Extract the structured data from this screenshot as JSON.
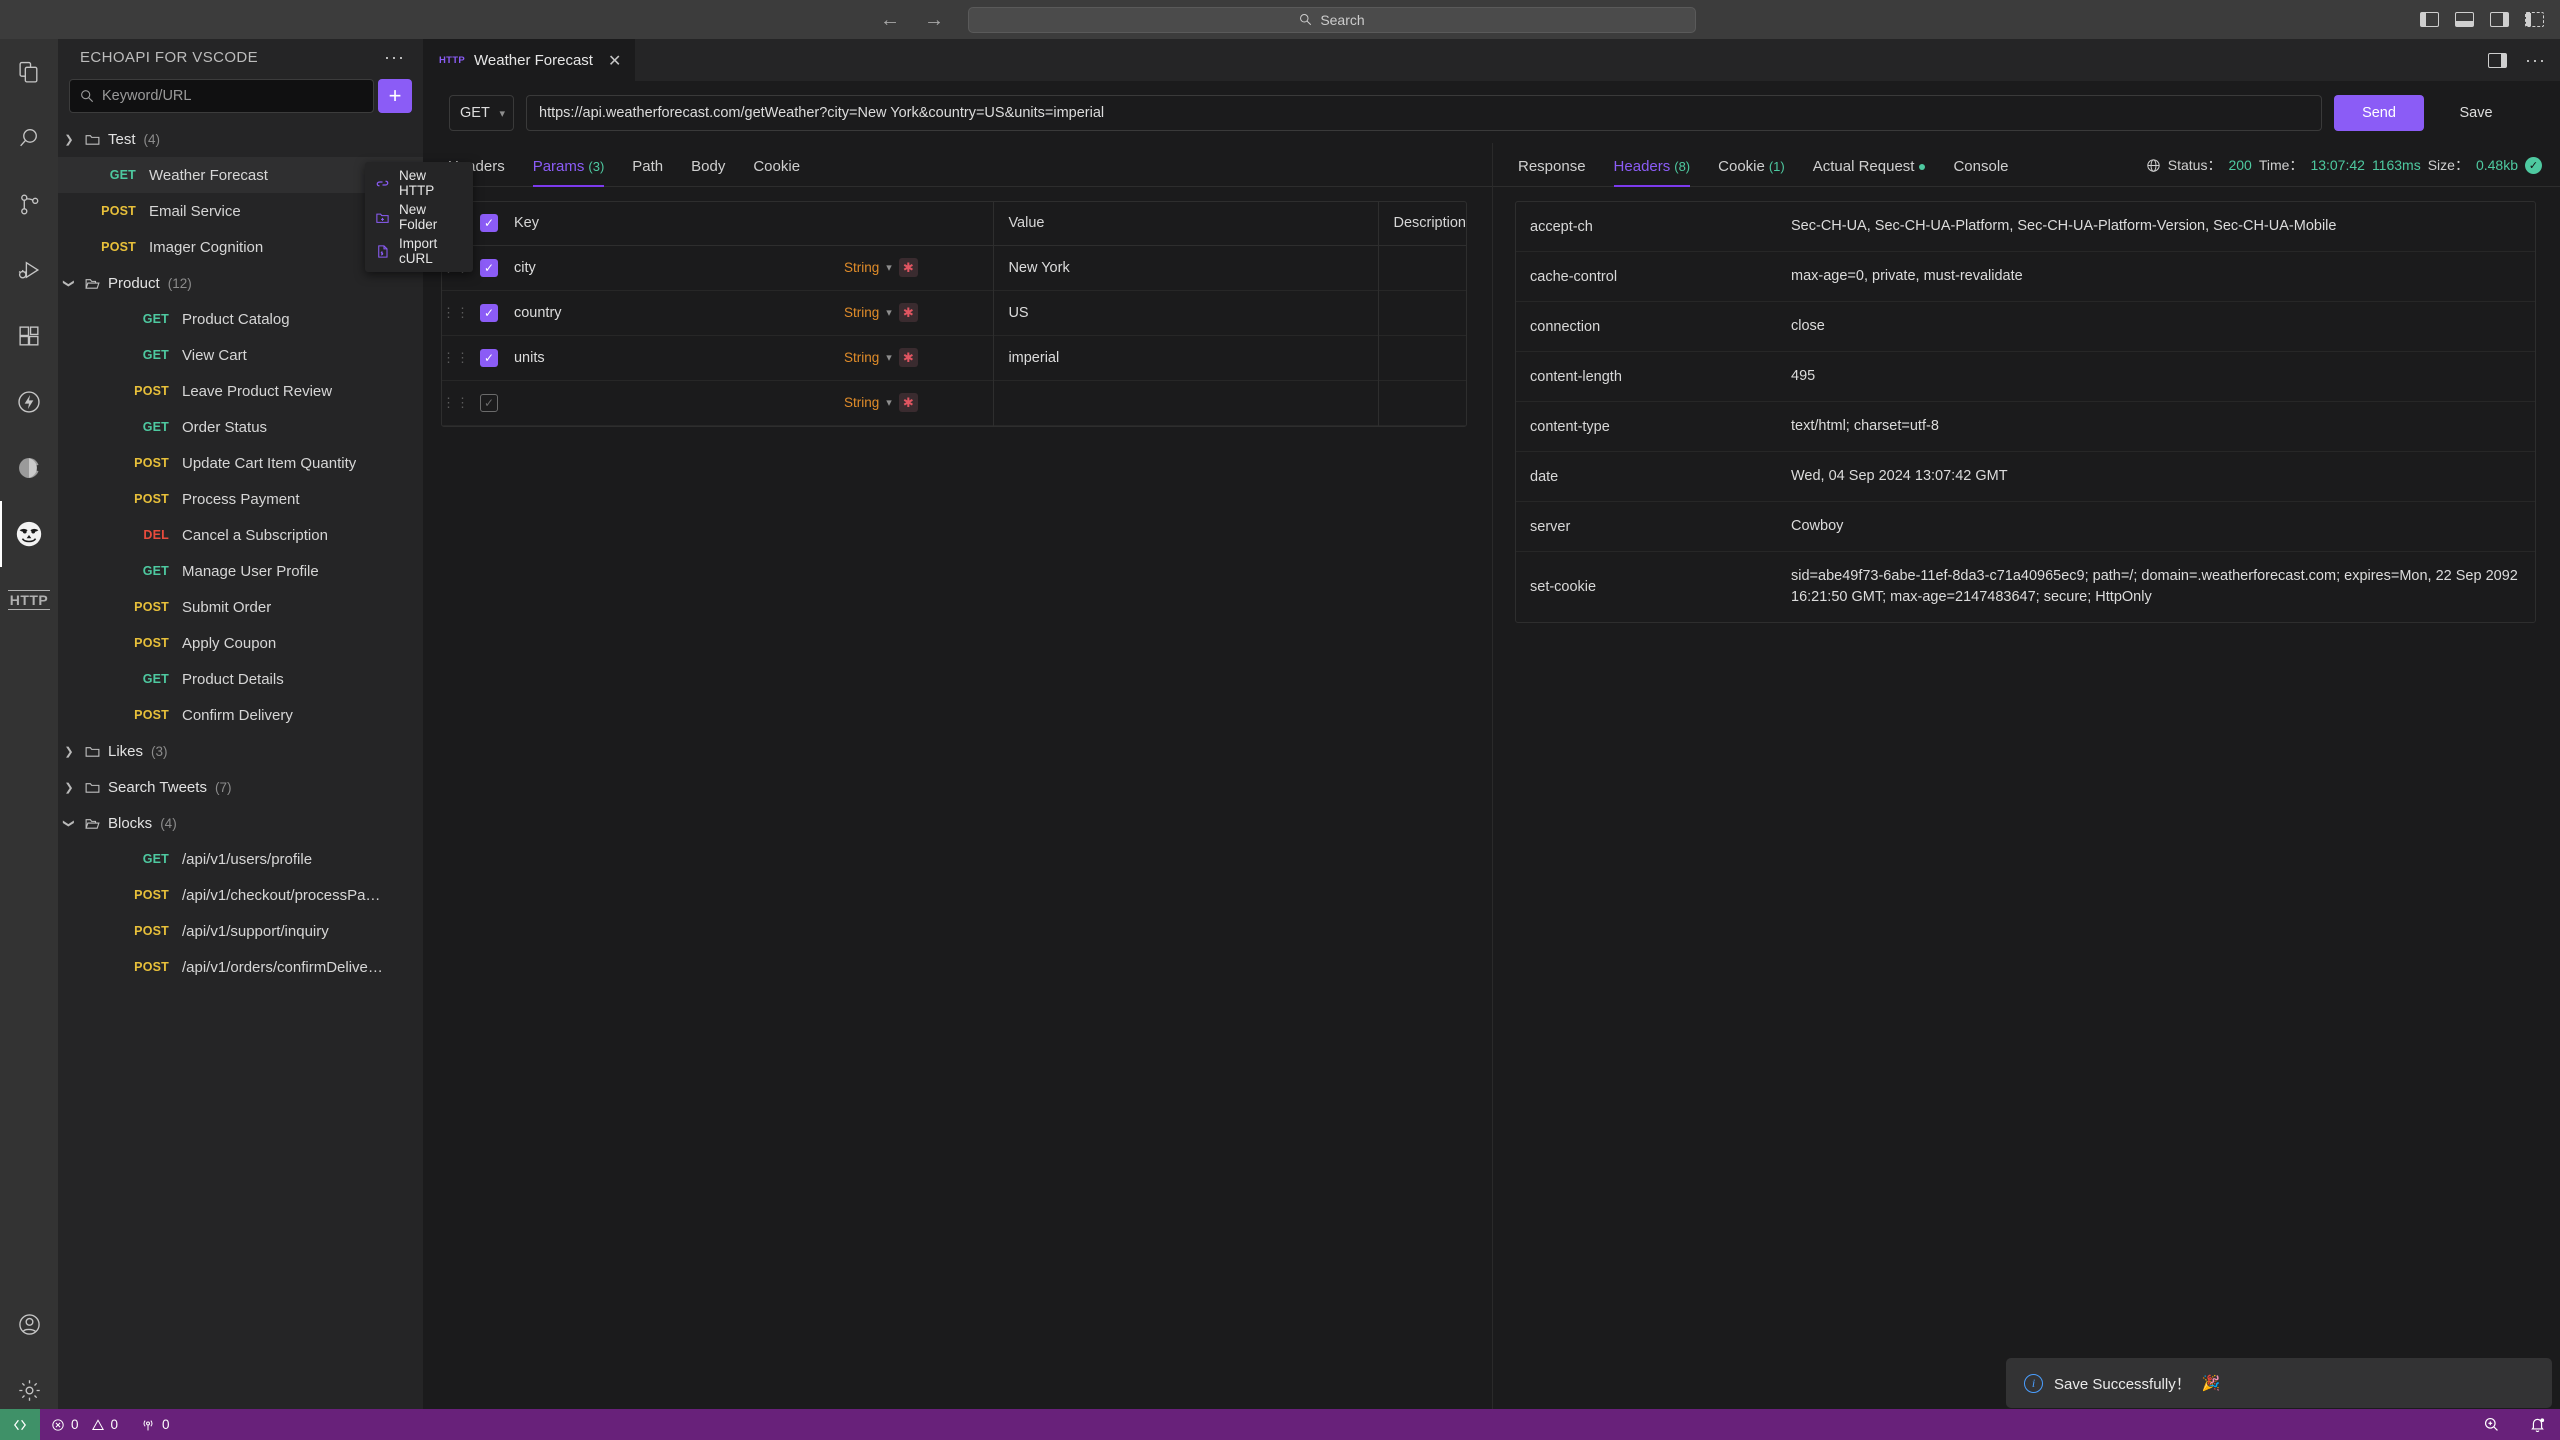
{
  "titlebar": {
    "search_placeholder": "Search",
    "back_icon": "arrow-left-icon",
    "forward_icon": "arrow-right-icon"
  },
  "activitybar": {
    "items": [
      {
        "icon": "explorer-files-icon",
        "active": false
      },
      {
        "icon": "search-icon",
        "active": false
      },
      {
        "icon": "source-control-branch-icon",
        "active": false
      },
      {
        "icon": "run-and-debug-icon",
        "active": false
      },
      {
        "icon": "extensions-icon",
        "active": false
      },
      {
        "icon": "lightning-bolt-circle-icon",
        "active": false
      },
      {
        "icon": "pie-chart-icon",
        "active": false
      },
      {
        "icon": "echoapi-owl-icon",
        "active": true
      },
      {
        "icon": "http-text-icon",
        "active": false
      }
    ],
    "bottom": [
      {
        "icon": "account-icon"
      },
      {
        "icon": "gear-icon"
      }
    ],
    "http_label": "HTTP"
  },
  "sidebar": {
    "title": "ECHOAPI FOR VSCODE",
    "more_label": "···",
    "search_placeholder": "Keyword/URL",
    "add_label": "+",
    "context_menu": [
      {
        "label": "New HTTP",
        "icon": "http-new-icon"
      },
      {
        "label": "New Folder",
        "icon": "folder-plus-icon"
      },
      {
        "label": "Import cURL",
        "icon": "import-curl-icon"
      }
    ],
    "tree": [
      {
        "kind": "folder",
        "name": "Test",
        "count": "(4)",
        "expanded": false,
        "indent": 0
      },
      {
        "kind": "request",
        "method": "GET",
        "name": "Weather Forecast",
        "selected": true,
        "indent": 0
      },
      {
        "kind": "request",
        "method": "POST",
        "name": "Email Service",
        "selected": false,
        "indent": 0
      },
      {
        "kind": "request",
        "method": "POST",
        "name": "Imager Cognition",
        "selected": false,
        "indent": 0
      },
      {
        "kind": "folder",
        "name": "Product",
        "count": "(12)",
        "expanded": true,
        "indent": 0
      },
      {
        "kind": "request",
        "method": "GET",
        "name": "Product Catalog",
        "selected": false,
        "indent": 1
      },
      {
        "kind": "request",
        "method": "GET",
        "name": "View Cart",
        "selected": false,
        "indent": 1
      },
      {
        "kind": "request",
        "method": "POST",
        "name": "Leave Product Review",
        "selected": false,
        "indent": 1
      },
      {
        "kind": "request",
        "method": "GET",
        "name": "Order Status",
        "selected": false,
        "indent": 1
      },
      {
        "kind": "request",
        "method": "POST",
        "name": "Update Cart Item Quantity",
        "selected": false,
        "indent": 1
      },
      {
        "kind": "request",
        "method": "POST",
        "name": "Process Payment",
        "selected": false,
        "indent": 1
      },
      {
        "kind": "request",
        "method": "DEL",
        "name": "Cancel a Subscription",
        "selected": false,
        "indent": 1
      },
      {
        "kind": "request",
        "method": "GET",
        "name": "Manage User Profile",
        "selected": false,
        "indent": 1
      },
      {
        "kind": "request",
        "method": "POST",
        "name": "Submit Order",
        "selected": false,
        "indent": 1
      },
      {
        "kind": "request",
        "method": "POST",
        "name": "Apply Coupon",
        "selected": false,
        "indent": 1
      },
      {
        "kind": "request",
        "method": "GET",
        "name": "Product Details",
        "selected": false,
        "indent": 1
      },
      {
        "kind": "request",
        "method": "POST",
        "name": "Confirm Delivery",
        "selected": false,
        "indent": 1
      },
      {
        "kind": "folder",
        "name": "Likes",
        "count": "(3)",
        "expanded": false,
        "indent": 0
      },
      {
        "kind": "folder",
        "name": "Search Tweets",
        "count": "(7)",
        "expanded": false,
        "indent": 0
      },
      {
        "kind": "folder",
        "name": "Blocks",
        "count": "(4)",
        "expanded": true,
        "indent": 0
      },
      {
        "kind": "request",
        "method": "GET",
        "name": "/api/v1/users/profile",
        "selected": false,
        "indent": 1
      },
      {
        "kind": "request",
        "method": "POST",
        "name": "/api/v1/checkout/processPa…",
        "selected": false,
        "indent": 1
      },
      {
        "kind": "request",
        "method": "POST",
        "name": "/api/v1/support/inquiry",
        "selected": false,
        "indent": 1
      },
      {
        "kind": "request",
        "method": "POST",
        "name": "/api/v1/orders/confirmDelive…",
        "selected": false,
        "indent": 1
      }
    ]
  },
  "editor": {
    "tab": {
      "badge": "HTTP",
      "title": "Weather Forecast",
      "close": "✕"
    },
    "request": {
      "method": "GET",
      "url": "https://api.weatherforecast.com/getWeather?city=New York&country=US&units=imperial",
      "send_label": "Send",
      "save_label": "Save"
    },
    "request_tabs": [
      {
        "label": "Headers",
        "count": "",
        "active": false
      },
      {
        "label": "Params",
        "count": "(3)",
        "active": true
      },
      {
        "label": "Path",
        "count": "",
        "active": false
      },
      {
        "label": "Body",
        "count": "",
        "active": false
      },
      {
        "label": "Cookie",
        "count": "",
        "active": false
      }
    ],
    "params_table": {
      "columns": [
        "Key",
        "Value",
        "Description"
      ],
      "header_checked": true,
      "rows": [
        {
          "checked": true,
          "key": "city",
          "type": "String",
          "value": "New York",
          "description": ""
        },
        {
          "checked": true,
          "key": "country",
          "type": "String",
          "value": "US",
          "description": ""
        },
        {
          "checked": true,
          "key": "units",
          "type": "String",
          "value": "imperial",
          "description": ""
        },
        {
          "checked": false,
          "key": "",
          "type": "String",
          "value": "",
          "description": ""
        }
      ]
    }
  },
  "response": {
    "tabs": [
      {
        "label": "Response",
        "count": "",
        "active": false,
        "dot": false
      },
      {
        "label": "Headers",
        "count": "(8)",
        "active": true,
        "dot": false
      },
      {
        "label": "Cookie",
        "count": "(1)",
        "active": false,
        "dot": false
      },
      {
        "label": "Actual Request",
        "count": "",
        "active": false,
        "dot": true
      },
      {
        "label": "Console",
        "count": "",
        "active": false,
        "dot": false
      }
    ],
    "status": {
      "globe_icon": "globe-icon",
      "status_label": "Status：",
      "status_value": "200",
      "time_label": "Time：",
      "time_value": "13:07:42",
      "duration_value": "1163ms",
      "size_label": "Size：",
      "size_value": "0.48kb",
      "ok_icon": "check-circle-icon"
    },
    "headers": [
      {
        "name": "accept-ch",
        "value": "Sec-CH-UA, Sec-CH-UA-Platform, Sec-CH-UA-Platform-Version, Sec-CH-UA-Mobile"
      },
      {
        "name": "cache-control",
        "value": "max-age=0, private, must-revalidate"
      },
      {
        "name": "connection",
        "value": "close"
      },
      {
        "name": "content-length",
        "value": "495"
      },
      {
        "name": "content-type",
        "value": "text/html; charset=utf-8"
      },
      {
        "name": "date",
        "value": "Wed, 04 Sep 2024 13:07:42 GMT"
      },
      {
        "name": "server",
        "value": "Cowboy"
      },
      {
        "name": "set-cookie",
        "value": "sid=abe49f73-6abe-11ef-8da3-c71a40965ec9; path=/; domain=.weatherforecast.com; expires=Mon, 22 Sep 2092 16:21:50 GMT; max-age=2147483647; secure; HttpOnly"
      }
    ]
  },
  "toast": {
    "icon": "info-circle-icon",
    "message": "Save Successfully！",
    "emoji": "🎉"
  },
  "statusbar": {
    "remote_icon": "remote-window-icon",
    "errors": "0",
    "warnings": "0",
    "ports": "0",
    "search_icon": "zoom-in-icon",
    "bell_icon": "bell-dot-icon"
  },
  "colors": {
    "accent": "#8b5cf6",
    "get": "#4ec9a0",
    "post": "#e8c03a",
    "del": "#e84b3c",
    "statusbar": "#68217a",
    "type": "#e08c2a"
  }
}
